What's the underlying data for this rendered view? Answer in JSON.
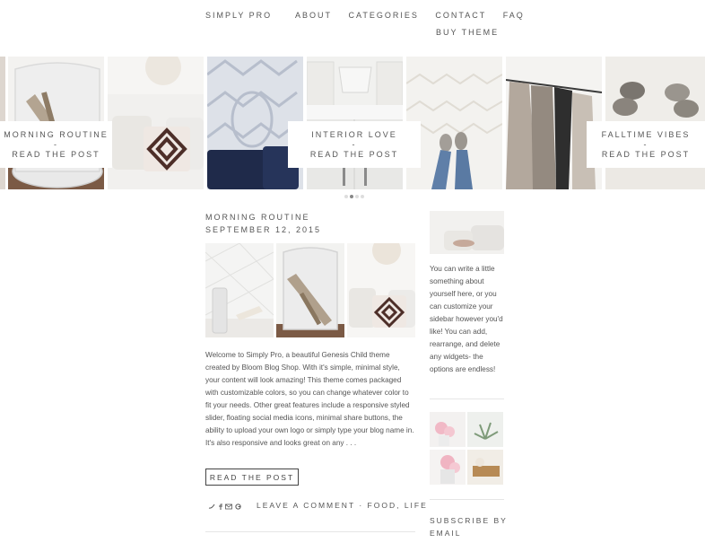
{
  "header": {
    "logo": "SIMPLY PRO",
    "nav": [
      "ABOUT",
      "CATEGORIES",
      "CONTACT",
      "FAQ"
    ],
    "buy": "BUY THEME"
  },
  "slider": {
    "slides": [
      {
        "title": "MORNING ROUTINE",
        "sep": "-",
        "cta": "READ THE POST"
      },
      {
        "title": "INTERIOR LOVE",
        "sep": "-",
        "cta": "READ THE POST"
      },
      {
        "title": "FALLTIME VIBES",
        "sep": "-",
        "cta": "READ THE POST"
      }
    ],
    "dots": 4,
    "active_dot": 2
  },
  "post": {
    "title": "MORNING ROUTINE",
    "date": "SEPTEMBER 12, 2015",
    "excerpt": "Welcome to Simply Pro, a beautiful Genesis Child theme created by Bloom Blog Shop. With it's simple, minimal style, your content will look amazing! This theme comes packaged with customizable colors, so you can change whatever color to fit your needs. Other great features include a responsive styled slider, floating social media icons, minimal share buttons, the ability to upload your own logo or simply type your blog name in. It's also responsive and looks great on any . . .",
    "read_more": "READ THE POST",
    "share_icons": [
      "twitter-icon",
      "facebook-icon",
      "email-icon",
      "google-plus-icon"
    ],
    "meta": "LEAVE A COMMENT · FOOD, LIFE"
  },
  "sidebar": {
    "about": "You can write a little something about yourself here, or you can customize your sidebar however you'd like! You can add, rearrange, and delete any widgets- the options are endless!",
    "subscribe": "SUBSCRIBE BY EMAIL"
  }
}
